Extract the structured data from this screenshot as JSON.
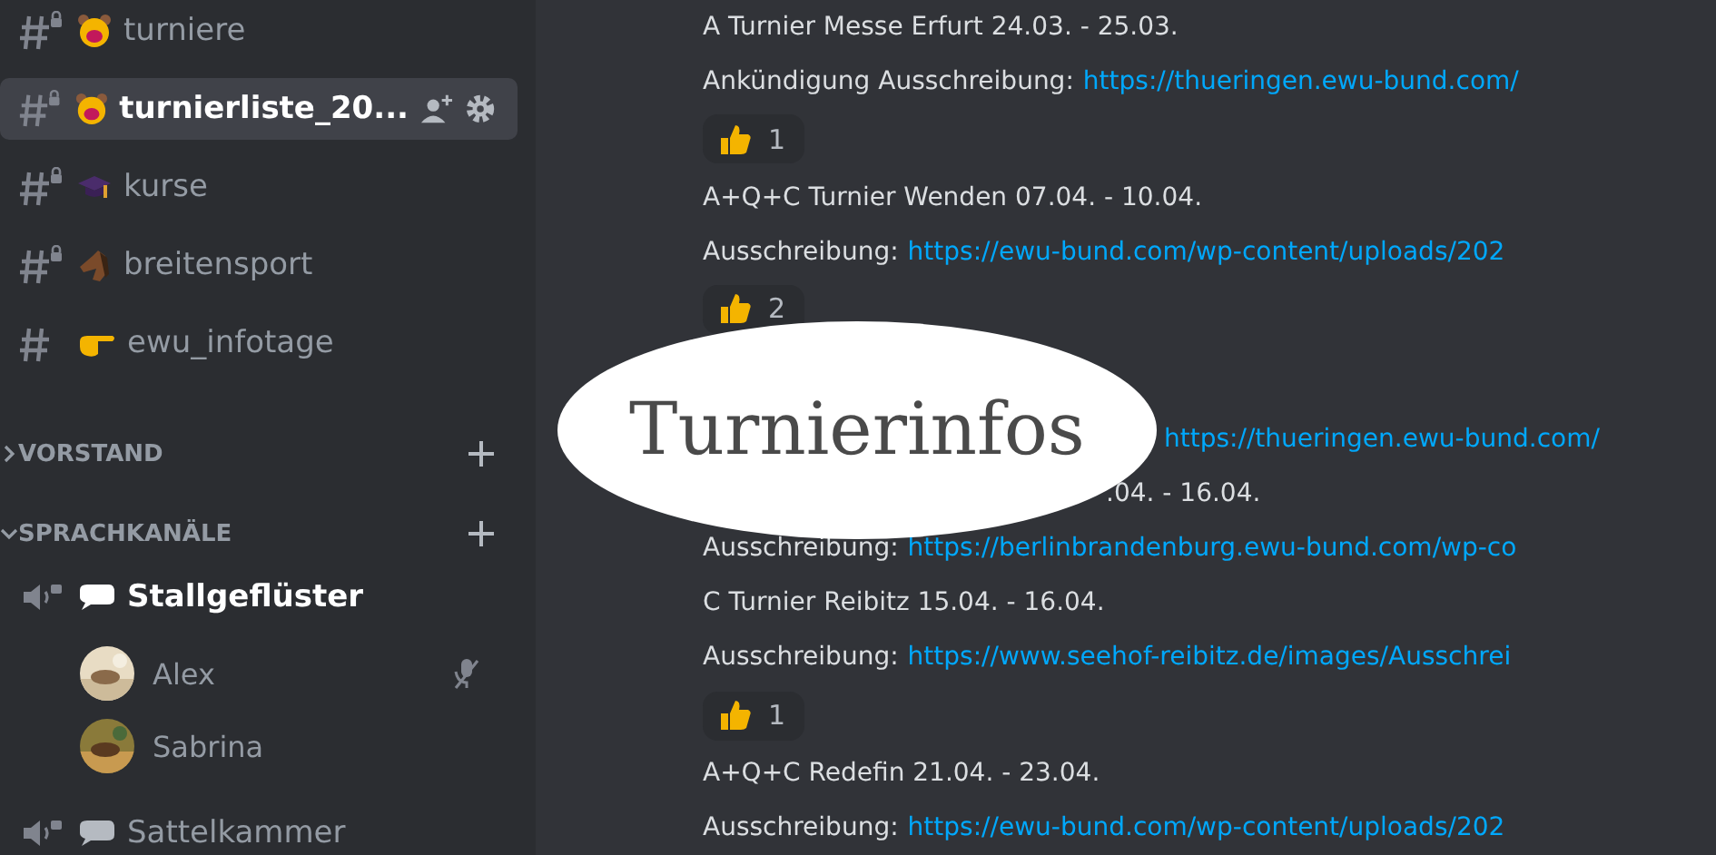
{
  "sidebar": {
    "channels": [
      {
        "name": "turniere",
        "kind": "face",
        "locked": true,
        "selected": false
      },
      {
        "name": "turnierliste_20...",
        "kind": "face",
        "locked": true,
        "selected": true
      },
      {
        "name": "kurse",
        "kind": "cap",
        "locked": true,
        "selected": false
      },
      {
        "name": "breitensport",
        "kind": "horse",
        "locked": true,
        "selected": false
      },
      {
        "name": "ewu_infotage",
        "kind": "hand",
        "locked": false,
        "selected": false
      }
    ],
    "categories": [
      {
        "name": "VORSTAND",
        "expanded": false
      },
      {
        "name": "SPRACHKANÄLE",
        "expanded": true,
        "voice_channels": [
          {
            "name": "Stallgeflüster",
            "active": true,
            "users": [
              {
                "name": "Alex",
                "muted": true
              },
              {
                "name": "Sabrina",
                "muted": false
              }
            ]
          },
          {
            "name": "Sattelkammer",
            "active": false
          }
        ]
      }
    ]
  },
  "messages": [
    {
      "kind": "title",
      "text": "A Turnier Messe Erfurt 24.03. - 25.03."
    },
    {
      "kind": "link",
      "label": "Ankündigung Ausschreibung:",
      "url": "https://thueringen.ewu-bund.com/"
    },
    {
      "kind": "reaction",
      "count": "1"
    },
    {
      "kind": "title",
      "text": "A+Q+C Turnier Wenden 07.04. - 10.04."
    },
    {
      "kind": "link",
      "label": "Ausschreibung:",
      "url": "https://ewu-bund.com/wp-content/uploads/202"
    },
    {
      "kind": "reaction",
      "count": "2"
    },
    {
      "kind": "link-fragment",
      "url": "https://thueringen.ewu-bund.com/"
    },
    {
      "kind": "title-fragment",
      "text": ".04. - 16.04."
    },
    {
      "kind": "link",
      "label": "Ausschreibung:",
      "url": "https://berlinbrandenburg.ewu-bund.com/wp-co"
    },
    {
      "kind": "title",
      "text": "C Turnier Reibitz 15.04. - 16.04."
    },
    {
      "kind": "link",
      "label": "Ausschreibung:",
      "url": "https://www.seehof-reibitz.de/images/Ausschrei"
    },
    {
      "kind": "reaction",
      "count": "1"
    },
    {
      "kind": "title",
      "text": "A+Q+C Redefin 21.04. - 23.04."
    },
    {
      "kind": "link",
      "label": "Ausschreibung:",
      "url": "https://ewu-bund.com/wp-content/uploads/202"
    }
  ],
  "overlay_label": {
    "text": "Turnierinfos"
  }
}
